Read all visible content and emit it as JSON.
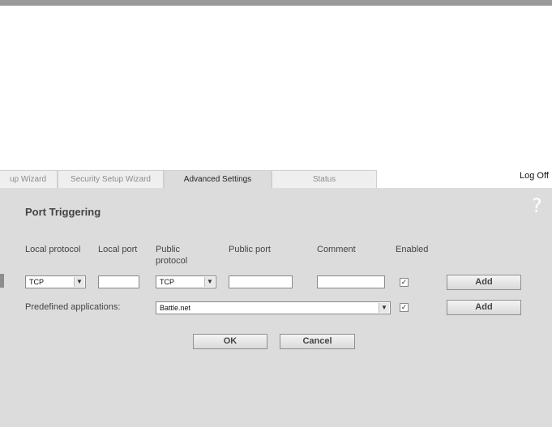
{
  "tabs": [
    {
      "label": "up Wizard"
    },
    {
      "label": "Security Setup Wizard"
    },
    {
      "label": "Advanced Settings"
    },
    {
      "label": "Status"
    }
  ],
  "logoff": "Log Off",
  "page": {
    "title": "Port Triggering",
    "help_glyph": "?"
  },
  "columns": {
    "local_protocol": "Local protocol",
    "local_port": "Local port",
    "public_protocol_line1": "Public",
    "public_protocol_line2": "protocol",
    "public_port": "Public port",
    "comment": "Comment",
    "enabled": "Enabled"
  },
  "entry_row": {
    "local_protocol": "TCP",
    "local_port": "",
    "public_protocol": "TCP",
    "public_port": "",
    "comment": "",
    "enabled_check": "✓",
    "add_label": "Add"
  },
  "predefined": {
    "label": "Predefined applications:",
    "selected": "Battle.net",
    "enabled_check": "✓",
    "add_label": "Add"
  },
  "footer": {
    "ok_label": "OK",
    "cancel_label": "Cancel"
  }
}
